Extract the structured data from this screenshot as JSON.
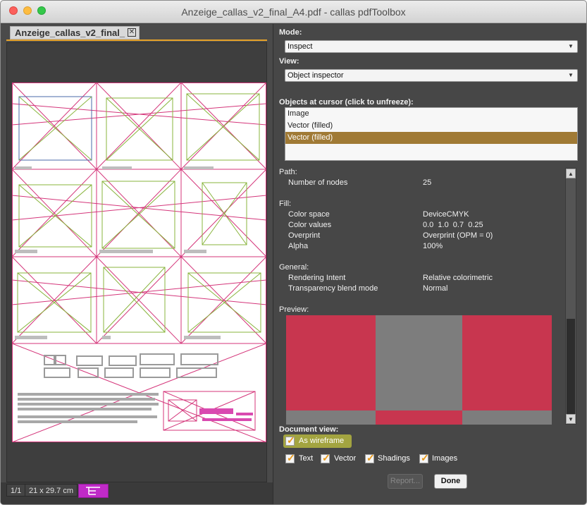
{
  "window": {
    "title": "Anzeige_callas_v2_final_A4.pdf - callas pdfToolbox"
  },
  "document": {
    "tab_label": "Anzeige_callas_v2_final_",
    "page_indicator": "1/1",
    "page_size": "21 x 29.7 cm"
  },
  "inspector": {
    "mode_label": "Mode:",
    "mode_value": "Inspect",
    "view_label": "View:",
    "view_value": "Object inspector",
    "objects_label": "Objects at cursor (click to unfreeze):",
    "objects": [
      "Image",
      "Vector (filled)",
      "Vector (filled)"
    ],
    "selected_object_index": 2
  },
  "properties": {
    "path_title": "Path:",
    "nodes_key": "Number of nodes",
    "nodes_value": "25",
    "fill_title": "Fill:",
    "colorspace_key": "Color space",
    "colorspace_value": "DeviceCMYK",
    "colorvalues_key": "Color values",
    "colorvalues_value": "0.0  1.0  0.7  0.25",
    "overprint_key": "Overprint",
    "overprint_value": "Overprint (OPM = 0)",
    "alpha_key": "Alpha",
    "alpha_value": "100%",
    "general_title": "General:",
    "intent_key": "Rendering Intent",
    "intent_value": "Relative colorimetric",
    "blend_key": "Transparency blend mode",
    "blend_value": "Normal",
    "preview_title": "Preview:"
  },
  "colors": {
    "preview_red": "#c8364f",
    "preview_gray": "#7d7d7d",
    "wire_pink": "#d4357a",
    "wire_green": "#88b43c",
    "accent": "#e6a32a",
    "selection": "#a07a35"
  },
  "document_view": {
    "label": "Document view:",
    "as_wireframe": "As wireframe",
    "text": "Text",
    "vector": "Vector",
    "shadings": "Shadings",
    "images": "Images"
  },
  "buttons": {
    "report": "Report...",
    "done": "Done"
  },
  "icons": {
    "close_tab": "close-icon",
    "dropdown": "chevron-down-icon",
    "structure": "structure-tree-icon"
  }
}
